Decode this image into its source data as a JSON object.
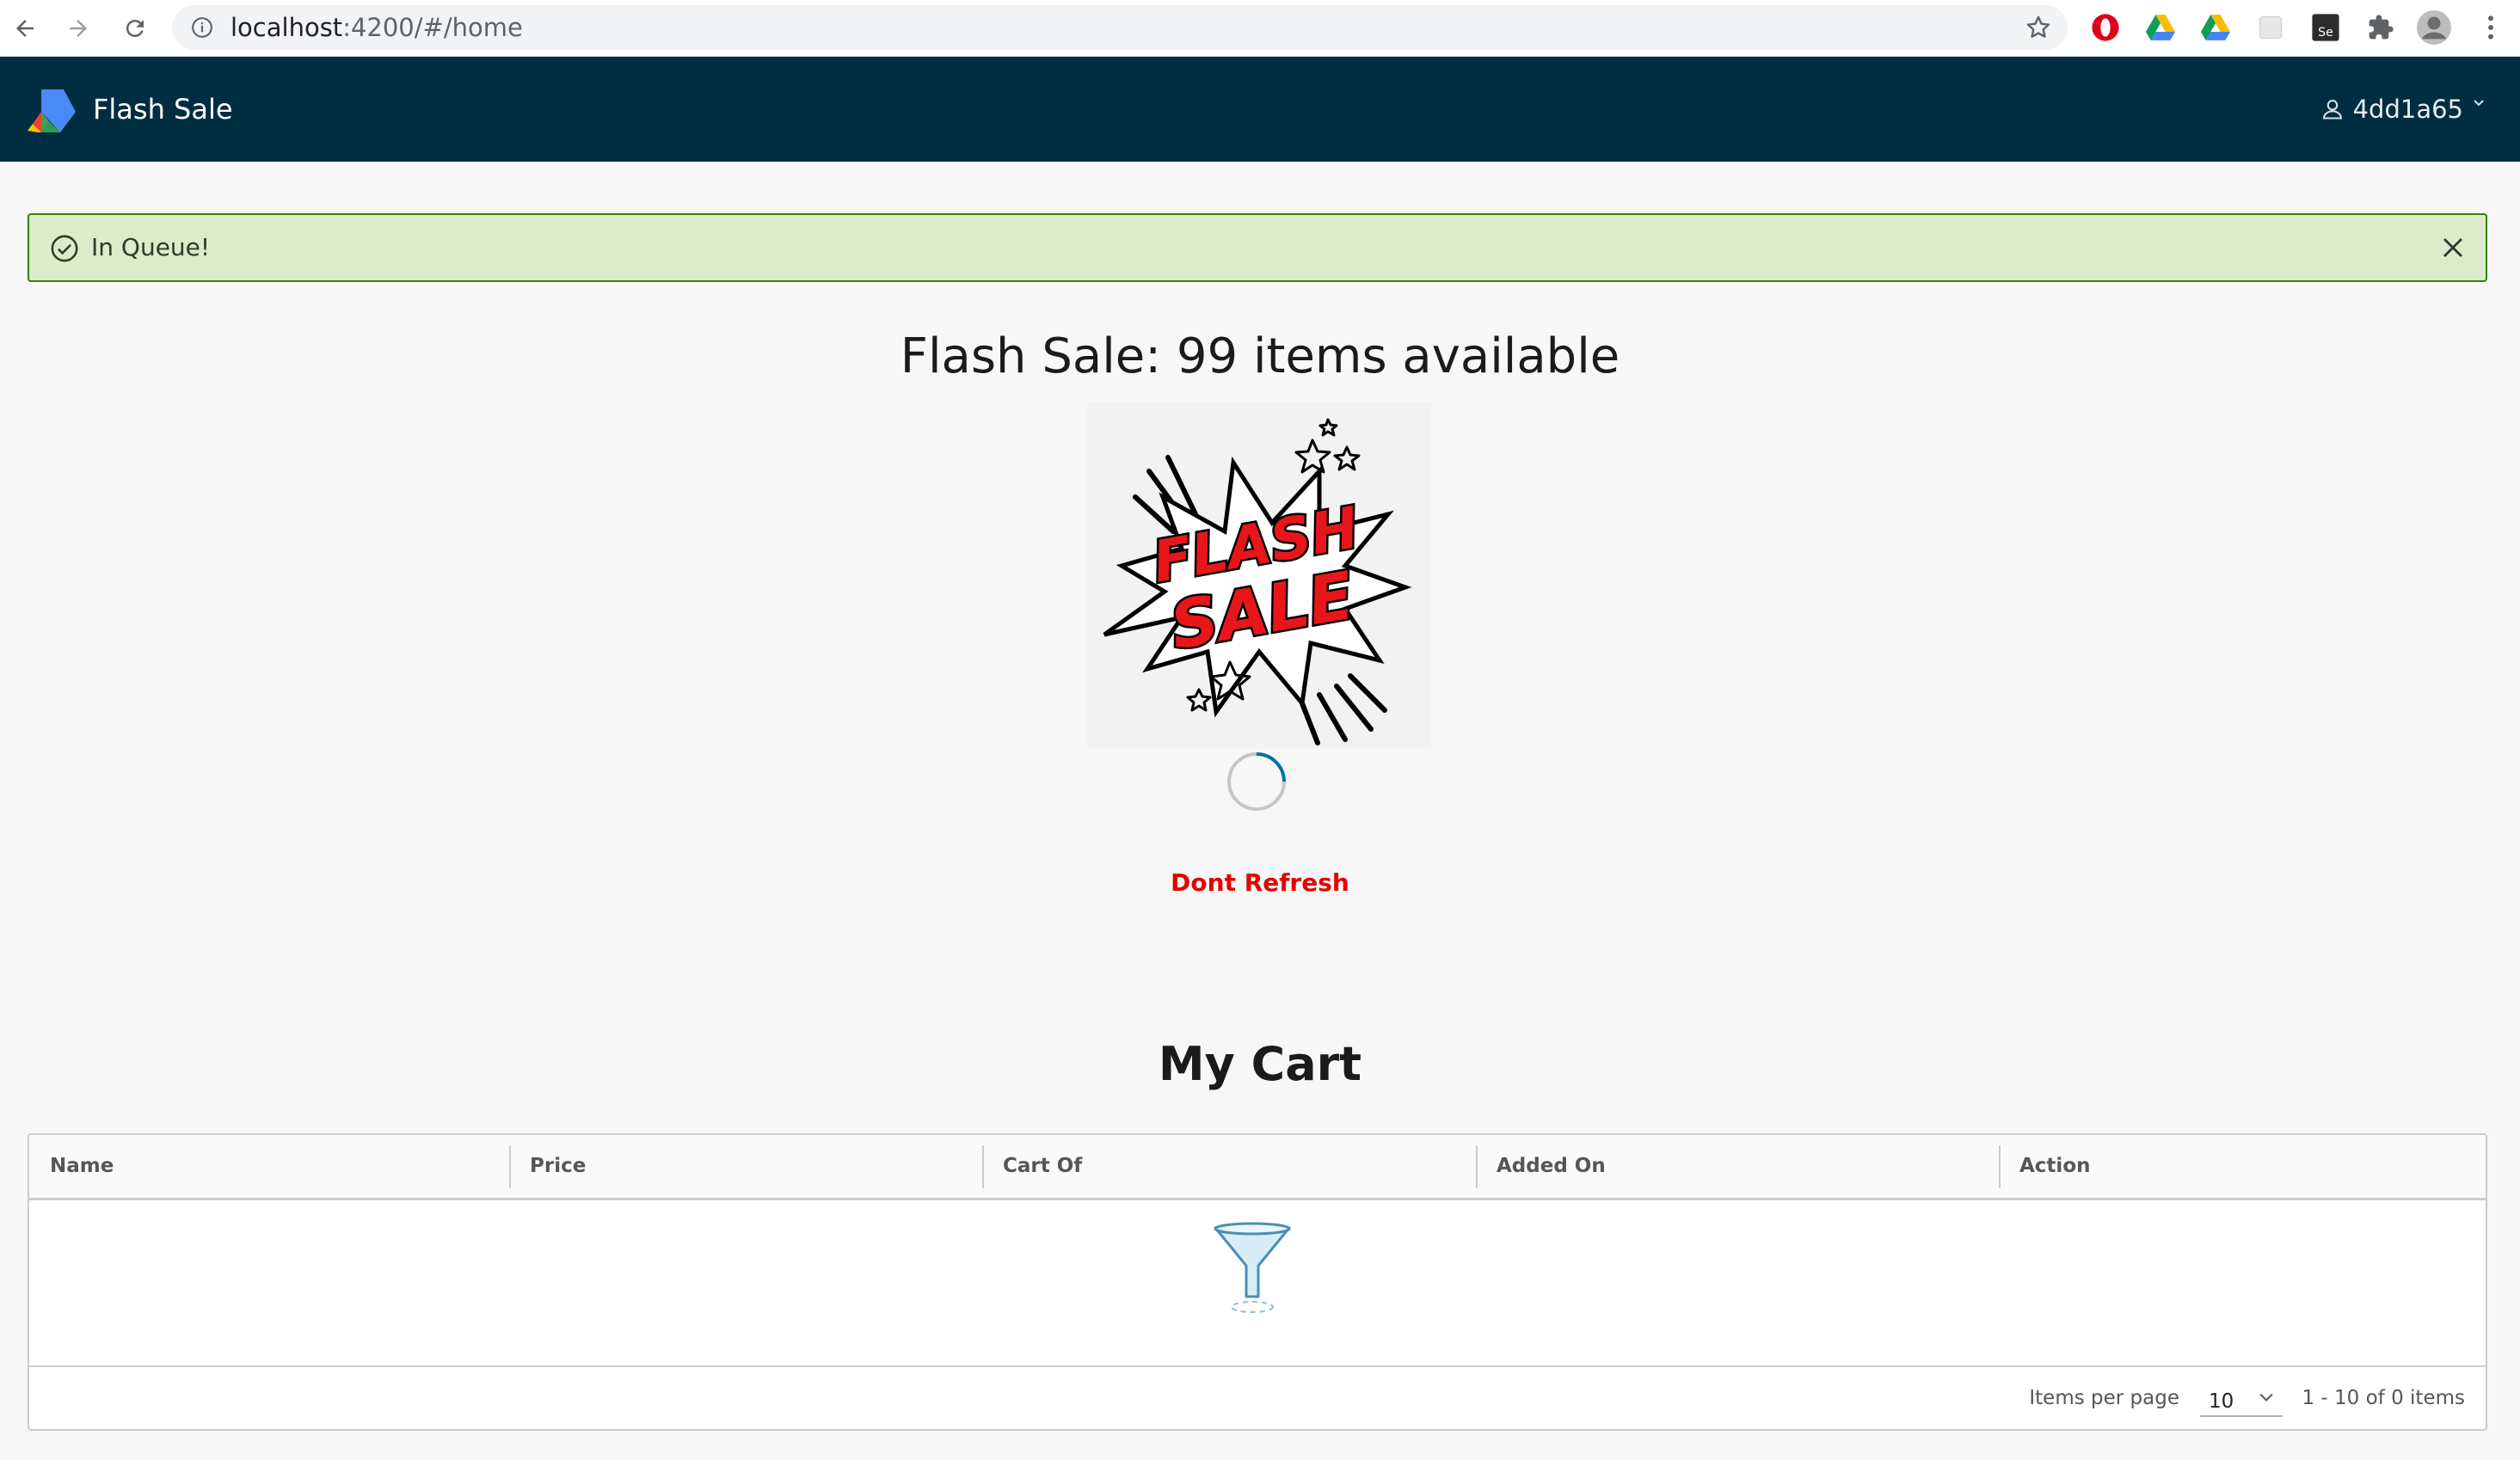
{
  "browser": {
    "url_host": "localhost",
    "url_rest": ":4200/#/home"
  },
  "app": {
    "title": "Flash Sale",
    "user": "4dd1a65",
    "header_color": "#002d42"
  },
  "alert": {
    "message": "In Queue!",
    "type": "success"
  },
  "sale": {
    "headline": "Flash Sale: 99 items available",
    "image_text_line1": "FLASH",
    "image_text_line2": "SALE",
    "warning": "Dont Refresh",
    "warning_color": "#e60000"
  },
  "cart": {
    "title": "My Cart",
    "columns": [
      "Name",
      "Price",
      "Cart Of",
      "Added On",
      "Action"
    ],
    "items_per_page_label": "Items per page",
    "items_per_page": "10",
    "page_info": "1 - 10 of 0 items"
  }
}
